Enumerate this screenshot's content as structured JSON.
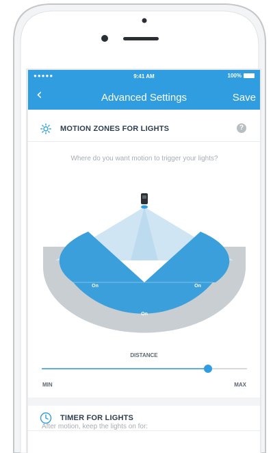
{
  "status_bar": {
    "carrier": "●●●●●",
    "time": "9:41 AM",
    "battery": "100%"
  },
  "nav": {
    "back_label": "‹",
    "title": "Advanced Settings",
    "save_label": "Save"
  },
  "motion_section": {
    "icon": "sun-icon",
    "title": "MOTION ZONES FOR LIGHTS",
    "help_icon": "question-icon",
    "help_label": "?",
    "prompt": "Where do you want motion to trigger your lights?",
    "zones": [
      {
        "name": "left",
        "label": "On",
        "active": true
      },
      {
        "name": "center",
        "label": "On",
        "active": true
      },
      {
        "name": "right",
        "label": "On",
        "active": true
      }
    ]
  },
  "distance": {
    "label": "DISTANCE",
    "min_label": "MIN",
    "max_label": "MAX",
    "value_fraction": 0.81
  },
  "timer_section": {
    "icon": "clock-icon",
    "title": "TIMER FOR LIGHTS",
    "description": "After motion, keep the lights on for:"
  },
  "colors": {
    "accent": "#2f9de0",
    "zone_fill": "#3b9fdc",
    "zone_light": "#cfe5f3",
    "ring": "#c9ced2"
  }
}
